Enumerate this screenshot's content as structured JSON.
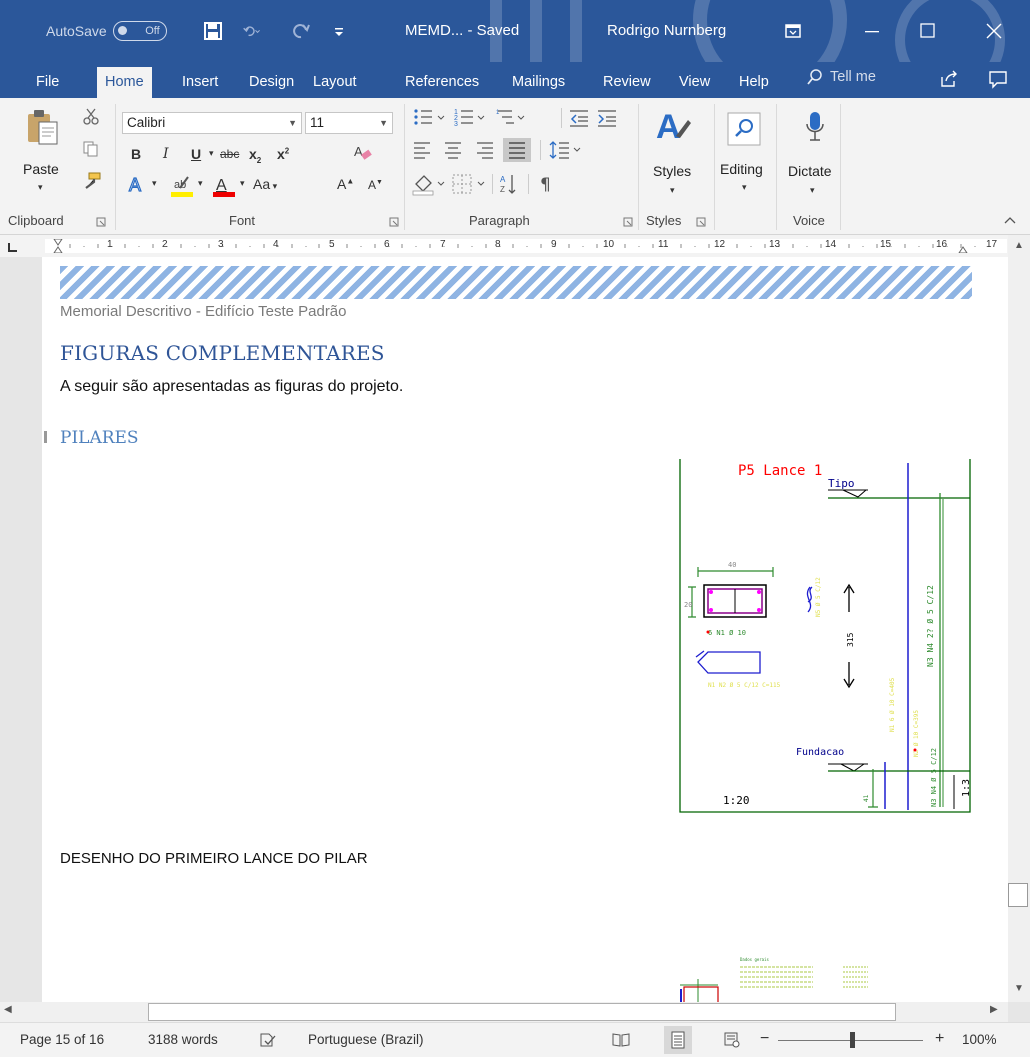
{
  "titlebar": {
    "autosave_label": "AutoSave",
    "autosave_state": "Off",
    "doc_title": "MEMD...  -  Saved",
    "user_name": "Rodrigo Nurnberg",
    "bg_color": "#2b579a"
  },
  "tabs": {
    "items": [
      "File",
      "Home",
      "Insert",
      "Design",
      "Layout",
      "References",
      "Mailings",
      "Review",
      "View",
      "Help"
    ],
    "active": "Home",
    "tell_me": "Tell me"
  },
  "ribbon": {
    "clipboard": {
      "paste": "Paste",
      "label": "Clipboard"
    },
    "font": {
      "name": "Calibri",
      "size": "11",
      "label": "Font",
      "change_case": "Aa"
    },
    "paragraph": {
      "label": "Paragraph"
    },
    "styles": {
      "button": "Styles",
      "label": "Styles"
    },
    "editing": {
      "button": "Editing"
    },
    "voice": {
      "button": "Dictate",
      "label": "Voice"
    }
  },
  "ruler": {
    "numbers": [
      "1",
      "2",
      "3",
      "4",
      "5",
      "6",
      "7",
      "8",
      "9",
      "10",
      "11",
      "12",
      "13",
      "14",
      "15",
      "16",
      "17"
    ]
  },
  "document": {
    "header_text": "Memorial Descritivo - Edifício Teste Padrão",
    "heading1": "FIGURAS COMPLEMENTARES",
    "intro": "A seguir são apresentadas as figuras do projeto.",
    "heading2": "PILARES",
    "figure": {
      "title": "P5 Lance 1",
      "level_top": "Tipo",
      "level_bottom": "Fundacao",
      "scale": "1:20",
      "scale_side": "1:3",
      "dim_width": "40",
      "dim_height": "20",
      "dim_length": "315",
      "bar_note": "6 N1 Ø 10"
    },
    "caption": "DESENHO DO PRIMEIRO LANCE DO PILAR"
  },
  "status": {
    "page": "Page 15 of 16",
    "words": "3188 words",
    "language": "Portuguese (Brazil)",
    "zoom": "100%"
  }
}
